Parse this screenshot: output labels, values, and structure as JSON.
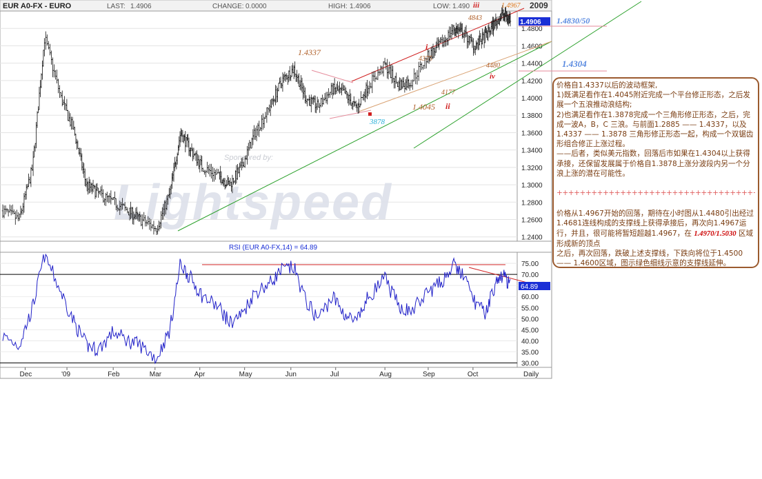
{
  "header": {
    "symbol": "EUR A0-FX - EURO",
    "last_label": "LAST:",
    "last_value": "1.4906",
    "change_label": "CHANGE:",
    "change_value": "0.0000",
    "high_label": "HIGH:",
    "high_value": "1.4906",
    "low_label": "LOW:",
    "low_value": "1.490",
    "year": "2009"
  },
  "price_axis": {
    "ticks": [
      "1.4800",
      "1.4600",
      "1.4400",
      "1.4200",
      "1.4000",
      "1.3800",
      "1.3600",
      "1.3400",
      "1.3200",
      "1.3000",
      "1.2800",
      "1.2600",
      "1.2400"
    ],
    "current": "1.4906"
  },
  "rsi_axis": {
    "ticks": [
      "75.00",
      "70.00",
      "65.00",
      "60.00",
      "55.00",
      "50.00",
      "45.00",
      "40.00",
      "35.00",
      "30.00"
    ],
    "current": "64.89"
  },
  "x_axis": {
    "labels": [
      "Dec",
      "'09",
      "Feb",
      "Mar",
      "Apr",
      "May",
      "Jun",
      "Jul",
      "Aug",
      "Sep",
      "Oct",
      "Daily"
    ]
  },
  "rsi_title": "RSI (EUR A0-FX,14) = 64.89",
  "watermark": {
    "brand": "Lightspeed",
    "sponsored": "Sponsored by:"
  },
  "annotations": {
    "p14337": "1.4337",
    "p3878": "3878",
    "p14045": "1.4045",
    "p4375": "4375",
    "p4177": "4177",
    "p4843": "4843",
    "p4480": "4480",
    "p14967": "1.4967",
    "w_i": "i",
    "w_ii": "ii",
    "w_iii": "iii",
    "w_iv": "iv",
    "right_14830": "1.4830/50",
    "right_14304": "1.4304"
  },
  "note": {
    "l1": "价格自1.4337以后的波动框架,",
    "l2": "1)既满足看作在1.4045附近完成一个平台修正形态，之后发展一个五浪推动浪结构;",
    "l3": "2)也满足看作在1.3878完成一个三角形修正形态，之后，完成一波A，B，C 三浪。与前面1.2885 —— 1.4337，以及1.4337 —— 1.3878 三角形修正形态一起，构成一个双锯齿形组合修正上涨过程。",
    "l4": "——后者，类似美元指数，回落后市如果在1.4304以上获得承接，还保留发展属于价格自1.3878上涨分波段内另一个分浪上涨的潜在可能性。",
    "sep": "++++++++++++++++++++++++++++++++++++",
    "l5a": "价格从1.4967开始的回落，期待在小时图从1.4480引出经过1.4681连线构成的支撑线上获得承接后，再次向1.4967运行，并且，很可能将暂短超越1.4967，在",
    "l5b": "1.4970/1.5030",
    "l5c": "区域形成新的顶点",
    "l6": "之后，再次回落，跌破上述支撑线，下跌向将位于1.4500 —— 1.4600区域，图示绿色细线示意的支撑线延伸。"
  },
  "colors": {
    "price_bar": "#111111",
    "rsi_line": "#2020c8",
    "channel": "#d02020",
    "support": "#20a020",
    "current_box": "#1a2fd6",
    "note_text": "#7a3d12",
    "note_border": "#9b5a2e"
  },
  "chart_data": {
    "type": "line",
    "title": "EUR A0-FX - EURO",
    "timeframe": "Daily",
    "x": [
      "2008-11-20",
      "2008-12-01",
      "2008-12-10",
      "2008-12-18",
      "2008-12-29",
      "2009-01-07",
      "2009-01-15",
      "2009-01-23",
      "2009-02-02",
      "2009-02-12",
      "2009-02-20",
      "2009-03-03",
      "2009-03-12",
      "2009-03-19",
      "2009-03-26",
      "2009-04-03",
      "2009-04-14",
      "2009-04-21",
      "2009-04-29",
      "2009-05-08",
      "2009-05-18",
      "2009-05-26",
      "2009-06-03",
      "2009-06-11",
      "2009-06-19",
      "2009-06-29",
      "2009-07-07",
      "2009-07-15",
      "2009-07-23",
      "2009-08-03",
      "2009-08-12",
      "2009-08-20",
      "2009-09-01",
      "2009-09-09",
      "2009-09-18",
      "2009-09-24",
      "2009-10-02",
      "2009-10-09",
      "2009-10-15",
      "2009-10-21",
      "2009-10-26"
    ],
    "series": [
      {
        "values": [
          1.27,
          1.26,
          1.32,
          1.47,
          1.4,
          1.36,
          1.3,
          1.29,
          1.28,
          1.27,
          1.26,
          1.25,
          1.29,
          1.36,
          1.34,
          1.32,
          1.31,
          1.3,
          1.32,
          1.36,
          1.39,
          1.42,
          1.4337,
          1.4,
          1.39,
          1.41,
          1.405,
          1.3878,
          1.415,
          1.4375,
          1.415,
          1.4177,
          1.448,
          1.46,
          1.48,
          1.475,
          1.46,
          1.47,
          1.4843,
          1.4967,
          1.4906
        ]
      },
      {
        "name": "RSI (EUR A0-FX,14)",
        "values": [
          42,
          38,
          55,
          79,
          62,
          48,
          38,
          36,
          44,
          40,
          38,
          32,
          45,
          75,
          68,
          60,
          55,
          48,
          52,
          62,
          66,
          72,
          73,
          58,
          50,
          60,
          52,
          48,
          60,
          68,
          56,
          53,
          62,
          66,
          74,
          70,
          58,
          52,
          64,
          70,
          64.89
        ]
      }
    ],
    "ylim": [
      1.235,
      1.5
    ],
    "rsi_ylim": [
      28,
      80
    ],
    "rsi_levels": [
      70,
      30
    ],
    "annotations": [
      "1.4337",
      "3878",
      "1.4045",
      "4375",
      "4177",
      "4843",
      "4480",
      "1.4967",
      "i",
      "ii",
      "iii",
      "iv",
      "1.4830/50",
      "1.4304"
    ]
  }
}
